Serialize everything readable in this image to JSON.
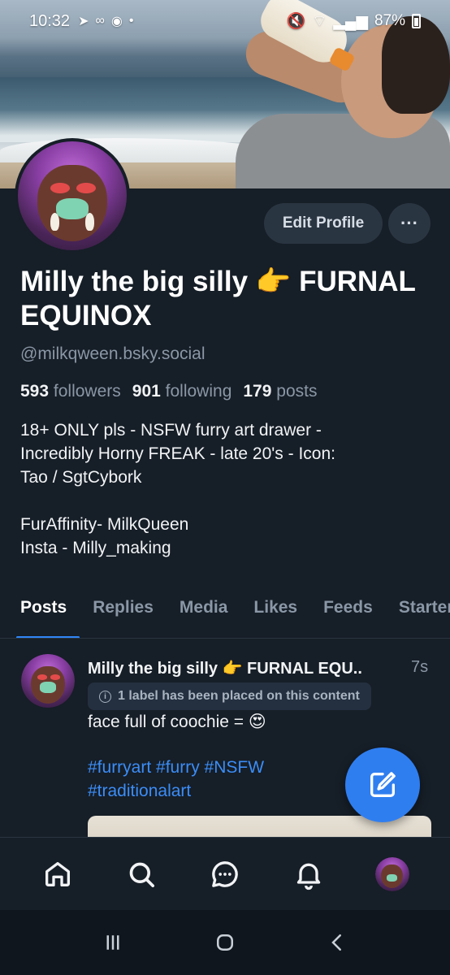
{
  "status_bar": {
    "time": "10:32",
    "battery": "87%"
  },
  "profile": {
    "edit_button": "Edit Profile",
    "more_button": "···",
    "display_name": "Milly the big silly 👉 FURNAL EQUINOX",
    "handle": "@milkqween.bsky.social",
    "followers_count": "593",
    "followers_label": "followers",
    "following_count": "901",
    "following_label": "following",
    "posts_count": "179",
    "posts_label": "posts",
    "bio_lines": [
      "18+ ONLY pls - NSFW furry art drawer -",
      "Incredibly Horny FREAK - late 20's - Icon:",
      "Tao / SgtCybork",
      "",
      "FurAffinity- MilkQueen",
      "Insta - Milly_making"
    ]
  },
  "tabs": [
    "Posts",
    "Replies",
    "Media",
    "Likes",
    "Feeds",
    "Starter Packs"
  ],
  "active_tab": "Posts",
  "post": {
    "author": "Milly the big silly 👉 FURNAL EQU..",
    "time": "7s",
    "label_notice": "1 label has been placed on this content",
    "text": "face full of coochie = 😍",
    "hashtags": "#furryart #furry #NSFW #traditionalart"
  },
  "bottom_nav": [
    "home-icon",
    "search-icon",
    "chat-icon",
    "bell-icon",
    "profile-avatar"
  ],
  "colors": {
    "background": "#161e27",
    "accent": "#2f86f6",
    "muted_text": "#8a97a6",
    "button_bg": "#2a3542"
  }
}
